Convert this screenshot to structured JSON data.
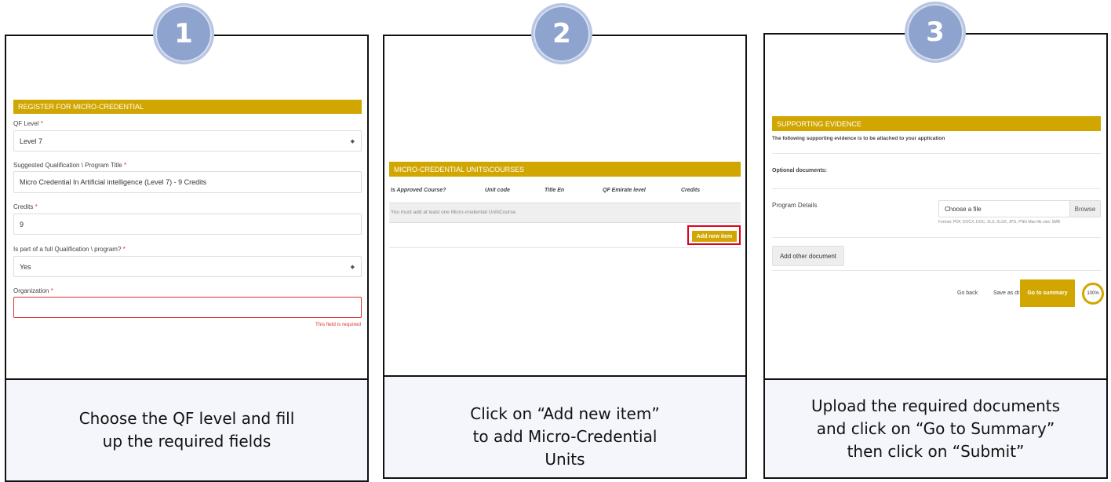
{
  "steps": [
    {
      "number": "1",
      "caption_line1": "Choose the QF level and fill",
      "caption_line2": "up the required fields"
    },
    {
      "number": "2",
      "caption_line1": "Click on “Add new item”",
      "caption_line2": "to add Micro-Credential",
      "caption_line3": "Units"
    },
    {
      "number": "3",
      "caption_line1": "Upload the required documents",
      "caption_line2": "and click on “Go to Summary”",
      "caption_line3": "then click on “Submit”"
    }
  ],
  "panel1": {
    "header": "REGISTER FOR MICRO-CREDENTIAL",
    "qf_label": "QF Level",
    "qf_value": "Level 7",
    "title_label": "Suggested Qualification \\ Program Title",
    "title_value": "Micro Credential In Artificial intelligence (Level 7) - 9 Credits",
    "credits_label": "Credits",
    "credits_value": "9",
    "part_label": "Is part of a full Qualification \\ program?",
    "part_value": "Yes",
    "org_label": "Organization",
    "org_value": "",
    "org_error": "This field is required",
    "required_mark": "*"
  },
  "panel2": {
    "header": "MICRO-CREDENTIAL UNITS\\COURSES",
    "columns": [
      "Is Approved Course?",
      "Unit code",
      "Title En",
      "QF Emirate level",
      "Credits"
    ],
    "empty_message": "You must add at least one Micro-credential Unit\\Course",
    "add_button": "Add new item",
    "highlight_color": "#e3001b"
  },
  "panel3": {
    "header": "SUPPORTING EVIDENCE",
    "intro": "The following supporting evidence is to be attached to your application",
    "optional": "Optional documents:",
    "program_details": "Program Details",
    "file_placeholder": "Choose a file",
    "browse": "Browse",
    "format_hint": "Format: PDF, DOCX, DOC, XLS, XLSX, JPG, PNG Max file size: 5MB",
    "add_other": "Add other document",
    "go_back": "Go back",
    "save_draft": "Save as draft",
    "go_summary": "Go to summary",
    "progress": "100%"
  },
  "colors": {
    "gold": "#d1a600",
    "badge": "#8fa3cf",
    "error": "#d33"
  }
}
